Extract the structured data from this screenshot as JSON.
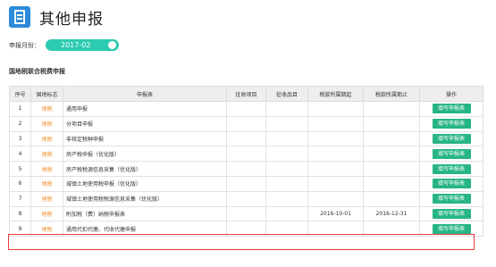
{
  "page": {
    "title": "其他申报"
  },
  "period": {
    "label": "申报月份：",
    "value": "2017-02"
  },
  "section": {
    "title": "国地税联合税费申报"
  },
  "table": {
    "headers": [
      "序号",
      "国地标志",
      "申报表",
      "征收项目",
      "征收品目",
      "税款所属期起",
      "税款所属期止",
      "操作"
    ],
    "rows": [
      {
        "no": "1",
        "tag": "地税",
        "name": "通用申报",
        "item": "",
        "sub": "",
        "start": "",
        "end": "",
        "action": "填写申报表"
      },
      {
        "no": "2",
        "tag": "地税",
        "name": "分项目申报",
        "item": "",
        "sub": "",
        "start": "",
        "end": "",
        "action": "填写申报表"
      },
      {
        "no": "3",
        "tag": "地税",
        "name": "非核定税种申报",
        "item": "",
        "sub": "",
        "start": "",
        "end": "",
        "action": "填写申报表"
      },
      {
        "no": "4",
        "tag": "地税",
        "name": "房产税申报（优化版）",
        "item": "",
        "sub": "",
        "start": "",
        "end": "",
        "action": "填写申报表"
      },
      {
        "no": "5",
        "tag": "地税",
        "name": "房产税税源信息采集（优化版）",
        "item": "",
        "sub": "",
        "start": "",
        "end": "",
        "action": "填写申报表"
      },
      {
        "no": "6",
        "tag": "地税",
        "name": "城镇土地使用税申报（优化版）",
        "item": "",
        "sub": "",
        "start": "",
        "end": "",
        "action": "填写申报表"
      },
      {
        "no": "7",
        "tag": "地税",
        "name": "城镇土地使用税税源信息采集（优化版）",
        "item": "",
        "sub": "",
        "start": "",
        "end": "",
        "action": "填写申报表"
      },
      {
        "no": "8",
        "tag": "地税",
        "name": "附加税（费）纳税申报表",
        "item": "",
        "sub": "",
        "start": "2016-10-01",
        "end": "2016-12-31",
        "action": "填写申报表"
      },
      {
        "no": "9",
        "tag": "地税",
        "name": "通用代扣代缴、代收代缴申报",
        "item": "",
        "sub": "",
        "start": "",
        "end": "",
        "action": "填写申报表"
      }
    ]
  },
  "colors": {
    "accent": "#2ccbb1",
    "button": "#27b584",
    "tag": "#f08a24",
    "highlight": "#e8403c",
    "logo": "#2b8ad9"
  }
}
